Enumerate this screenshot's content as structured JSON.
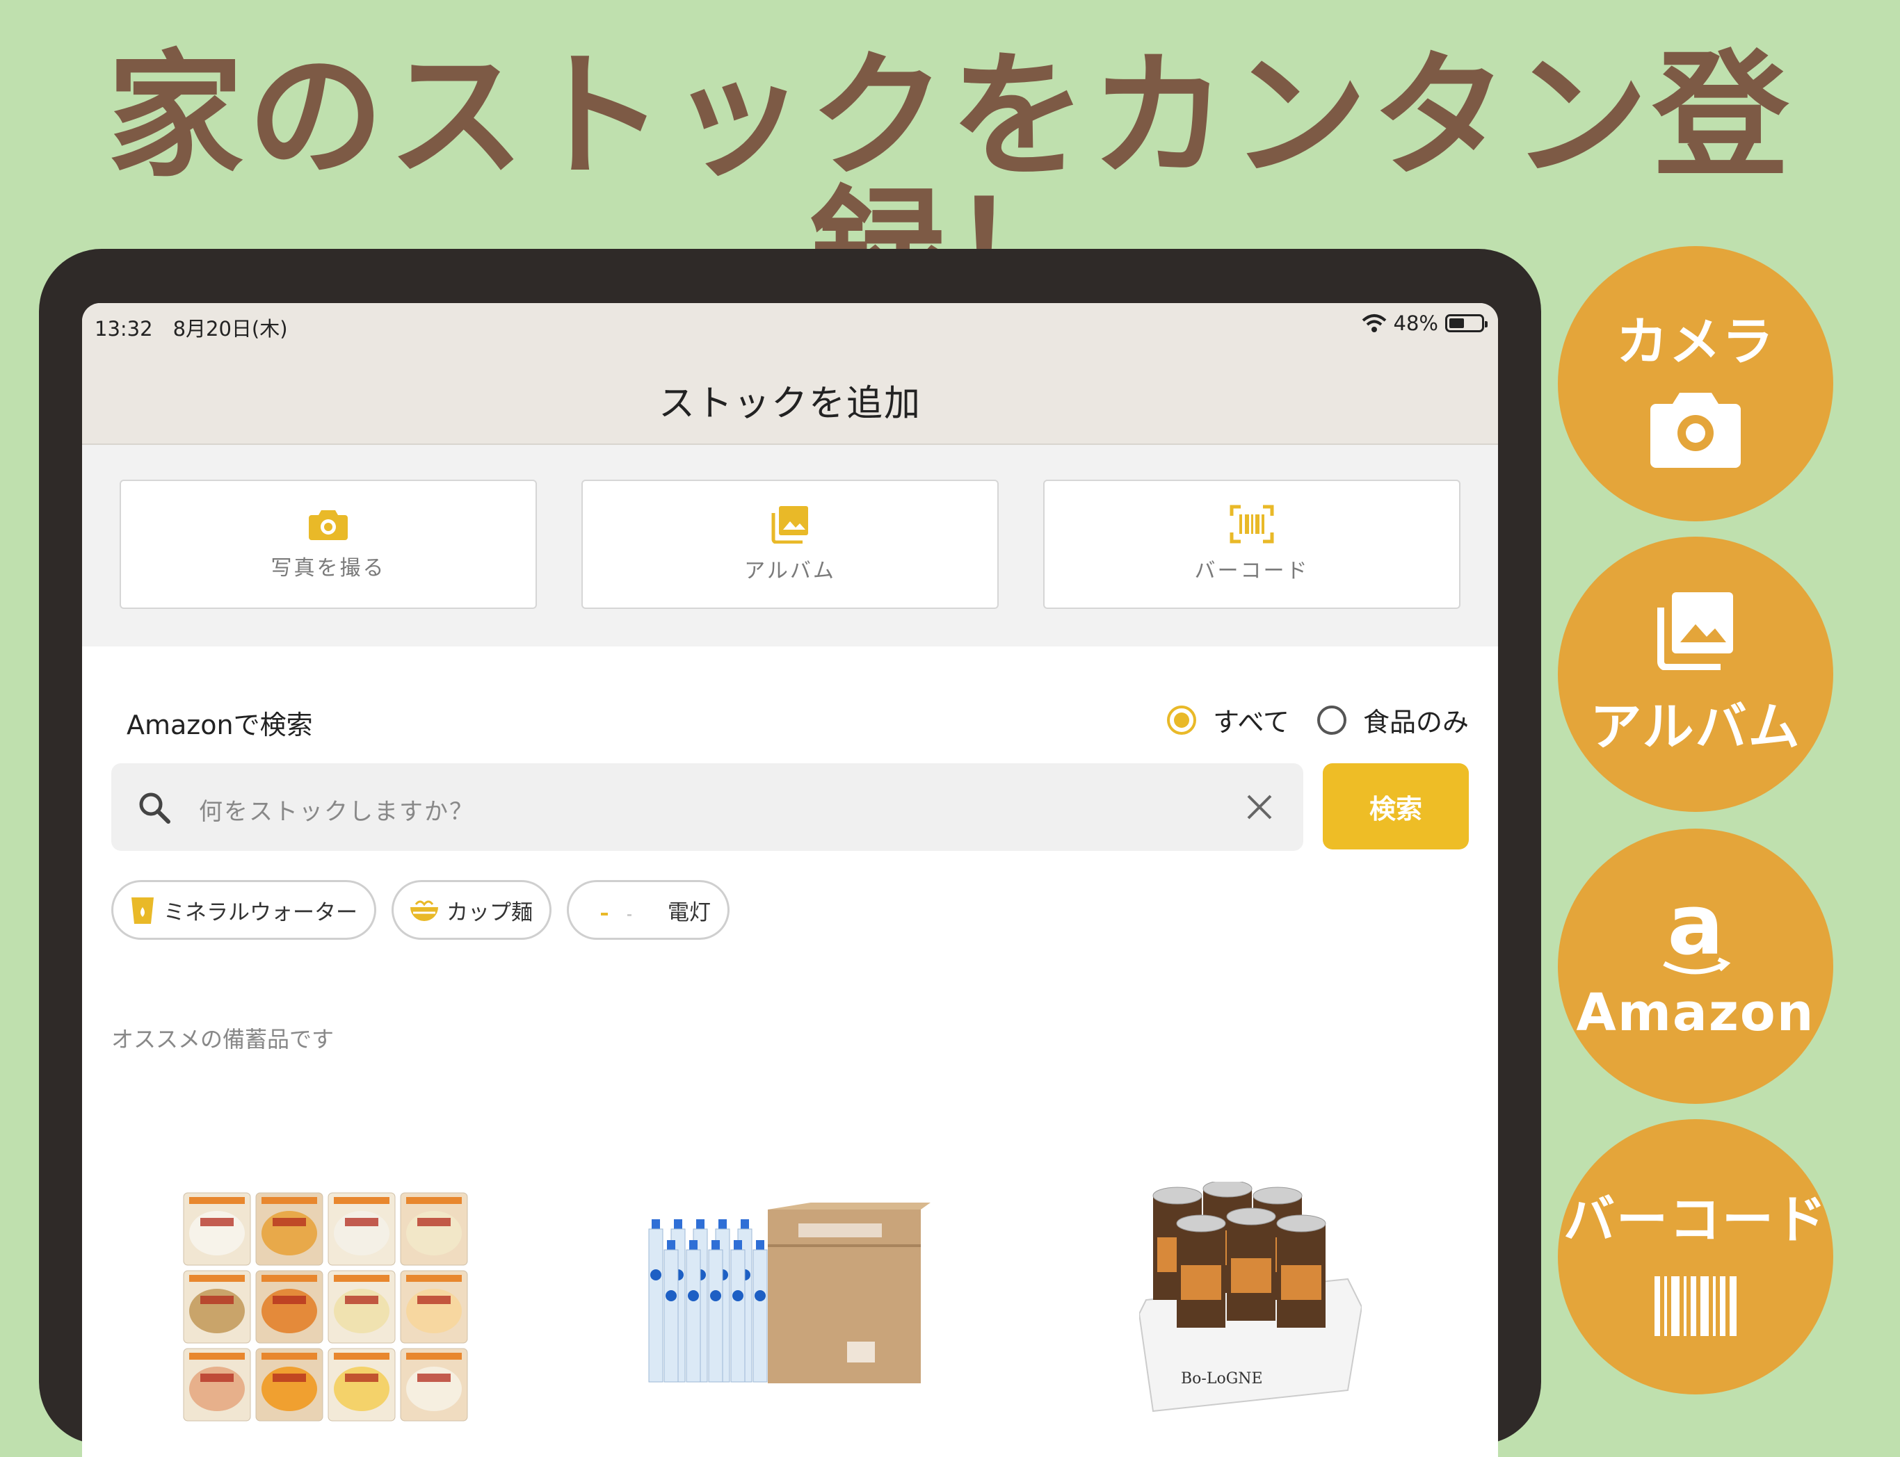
{
  "headline": "家のストックをカンタン登録！",
  "status_bar": {
    "time": "13:32　8月20日(木)",
    "battery": "48%",
    "battery_level": 0.48
  },
  "nav": {
    "title": "ストックを追加"
  },
  "actions": [
    {
      "label": "写真を撮る",
      "icon": "camera-icon"
    },
    {
      "label": "アルバム",
      "icon": "photo-album-icon"
    },
    {
      "label": "バーコード",
      "icon": "barcode-scan-icon"
    }
  ],
  "search": {
    "section_title": "Amazonで検索",
    "filters": [
      {
        "label": "すべて",
        "selected": true
      },
      {
        "label": "食品のみ",
        "selected": false
      }
    ],
    "placeholder": "何をストックしますか？",
    "button_label": "検索"
  },
  "chips": [
    {
      "label": "ミネラルウォーター",
      "icon": "water-cup-icon"
    },
    {
      "label": "カップ麺",
      "icon": "noodle-bowl-icon"
    },
    {
      "label": "電灯",
      "icon": "lamp-icon"
    }
  ],
  "recommend_label": "オススメの備蓄品です",
  "products": [
    {
      "name": "retort-rice-assortment-image"
    },
    {
      "name": "mineral-water-case-image"
    },
    {
      "name": "canned-bread-box-image",
      "brand_text": "Bo-LoGNE"
    }
  ],
  "features": [
    {
      "label": "カメラ",
      "icon": "camera-icon"
    },
    {
      "label": "アルバム",
      "icon": "photo-album-icon"
    },
    {
      "label": "Amazon",
      "icon": "amazon-logo-icon"
    },
    {
      "label": "バーコード",
      "icon": "barcode-icon"
    }
  ],
  "colors": {
    "background": "#bfe0ae",
    "headline": "#7d5a45",
    "accent": "#e9b928",
    "circle": "#e4a53a",
    "device": "#2f2a28"
  }
}
